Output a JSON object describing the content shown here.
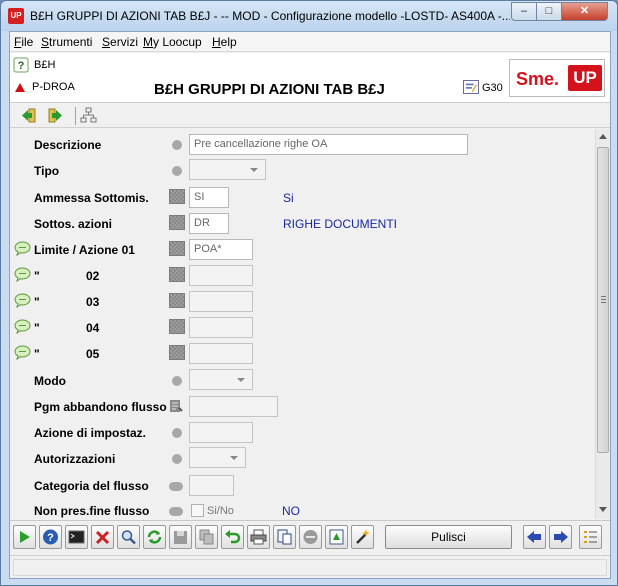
{
  "window": {
    "title": "B£H GRUPPI DI AZIONI TAB B£J  -  -- MOD - Configurazione modello -LOSTD- AS400A -...",
    "app_badge": "UP",
    "minimize": "–",
    "maximize": "□",
    "close": "✕"
  },
  "menu": {
    "items": [
      {
        "label": "File",
        "ul": "F",
        "rest": "ile"
      },
      {
        "label": "Strumenti",
        "ul": "S",
        "rest": "trumenti"
      },
      {
        "label": "Servizi",
        "ul": "S",
        "rest": "ervizi"
      },
      {
        "label": "My Loocup",
        "ul": "M",
        "rest": "y Loocup"
      },
      {
        "label": "Help",
        "ul": "H",
        "rest": "elp"
      }
    ]
  },
  "header": {
    "object_code": "B£H",
    "function_code": "P-DROA",
    "title": "B£H GRUPPI DI AZIONI TAB B£J",
    "view_code": "G30",
    "logo_text": "Sme.",
    "logo_badge": "UP"
  },
  "form": {
    "descrizione": {
      "label": "Descrizione",
      "value": "Pre cancellazione righe OA"
    },
    "tipo": {
      "label": "Tipo",
      "value": ""
    },
    "ammessa": {
      "label": "Ammessa  Sottomis.",
      "value": "SI",
      "decoded": "Si"
    },
    "sottos": {
      "label": "Sottos. azioni",
      "value": "DR",
      "decoded": "RIGHE DOCUMENTI"
    },
    "limite": {
      "label": "Limite / Azione 01",
      "value": "POA*"
    },
    "row02": {
      "ditto": "\"",
      "num": "02",
      "value": ""
    },
    "row03": {
      "ditto": "\"",
      "num": "03",
      "value": ""
    },
    "row04": {
      "ditto": "\"",
      "num": "04",
      "value": ""
    },
    "row05": {
      "ditto": "\"",
      "num": "05",
      "value": ""
    },
    "modo": {
      "label": "Modo",
      "value": ""
    },
    "pgm": {
      "label": "Pgm abbandono flusso",
      "value": ""
    },
    "azione_impostaz": {
      "label": "Azione di impostaz.",
      "value": ""
    },
    "autorizzazioni": {
      "label": "Autorizzazioni",
      "value": ""
    },
    "categoria": {
      "label": "Categoria del flusso",
      "value": ""
    },
    "non_pres": {
      "label": "Non pres.fine flusso",
      "checkbox_label": "Si/No",
      "decoded": "NO"
    }
  },
  "bottom": {
    "pulisci_label": "Pulisci"
  },
  "colors": {
    "decoded_text": "#1a28a0",
    "brand_red": "#d4121b"
  }
}
